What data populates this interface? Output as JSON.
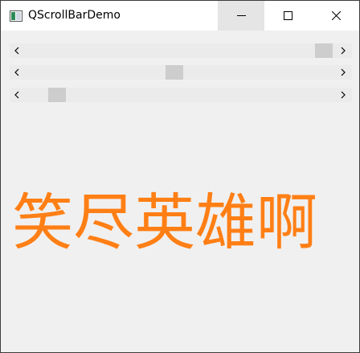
{
  "window": {
    "title": "QScrollBarDemo",
    "app_icon": "qt-window-icon",
    "controls": {
      "minimize": "minimize-icon",
      "maximize": "maximize-icon",
      "close": "close-icon"
    }
  },
  "scrollbars": [
    {
      "name": "scrollbar-1",
      "value_fraction": 0.96
    },
    {
      "name": "scrollbar-2",
      "value_fraction": 0.47
    },
    {
      "name": "scrollbar-3",
      "value_fraction": 0.08
    }
  ],
  "label": {
    "text": "笑尽英雄啊",
    "color": "#ff7f15"
  }
}
